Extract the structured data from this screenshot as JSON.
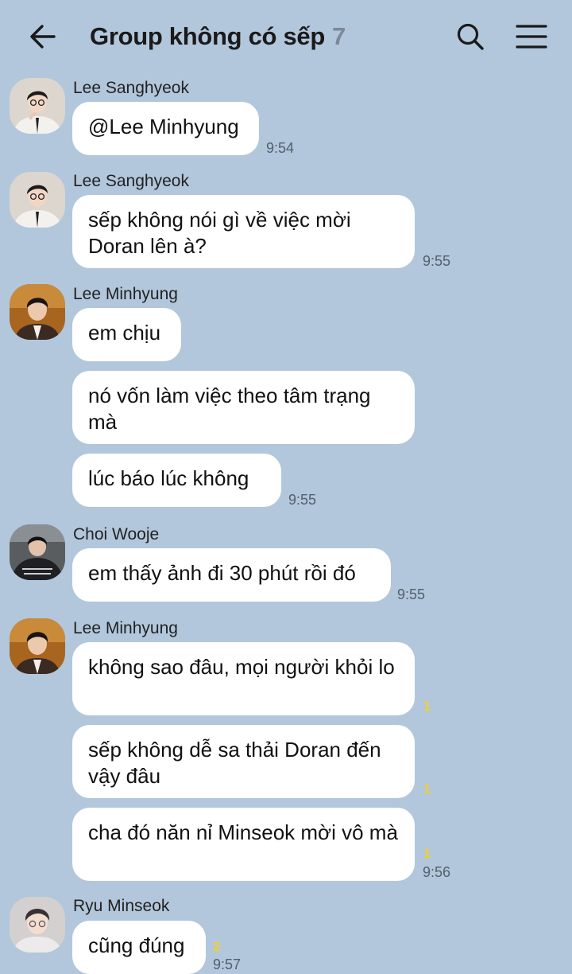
{
  "header": {
    "title": "Group không có sếp",
    "member_count": "7",
    "back_icon": "arrow-left-icon",
    "search_icon": "search-icon",
    "menu_icon": "hamburger-menu-icon"
  },
  "messages": [
    {
      "sender": "Lee Sanghyeok",
      "text": "@Lee Minhyung",
      "time": "9:54",
      "unread": ""
    },
    {
      "sender": "Lee Sanghyeok",
      "text": "sếp không nói gì về việc mời Doran lên à?",
      "time": "9:55",
      "unread": ""
    },
    {
      "sender": "Lee Minhyung",
      "text": "em chịu",
      "time": "",
      "unread": ""
    },
    {
      "sender": "",
      "text": "nó vốn làm việc theo tâm trạng mà",
      "time": "",
      "unread": ""
    },
    {
      "sender": "",
      "text": "lúc báo lúc không",
      "time": "9:55",
      "unread": ""
    },
    {
      "sender": "Choi Wooje",
      "text": "em thấy ảnh đi 30 phút rồi đó",
      "time": "9:55",
      "unread": ""
    },
    {
      "sender": "Lee Minhyung",
      "text": "không sao đâu, mọi người khỏi lo",
      "time": "",
      "unread": "1"
    },
    {
      "sender": "",
      "text": "sếp không dễ sa thải Doran đến vậy đâu",
      "time": "",
      "unread": "1"
    },
    {
      "sender": "",
      "text": "cha đó năn nỉ Minseok mời vô mà",
      "time": "9:56",
      "unread": "1"
    },
    {
      "sender": "Ryu Minseok",
      "text": "cũng đúng",
      "time": "9:57",
      "unread": "2"
    }
  ]
}
